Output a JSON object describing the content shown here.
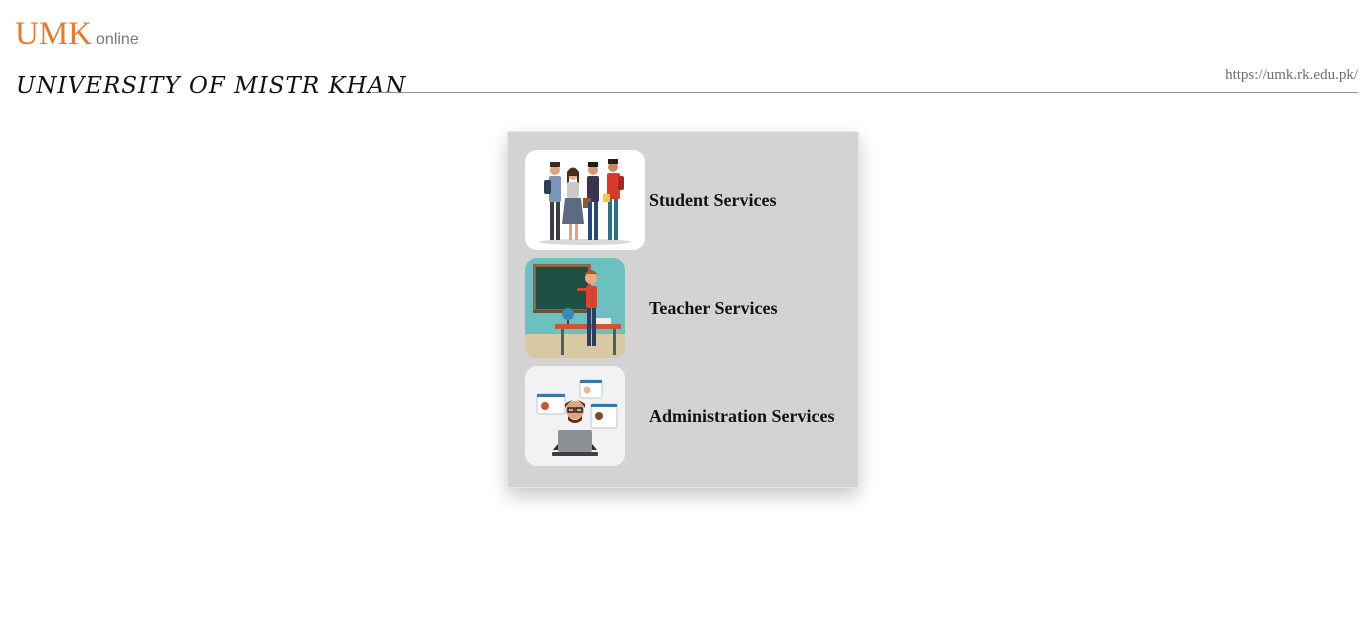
{
  "brand": {
    "name": "UMK",
    "suffix": "online"
  },
  "header": {
    "university_title": "UNIVERSITY OF MISTR KHAN",
    "url": "https://umk.rk.edu.pk/"
  },
  "services": [
    {
      "label": "Student Services",
      "icon": "students-illustration-icon"
    },
    {
      "label": "Teacher Services",
      "icon": "teacher-illustration-icon"
    },
    {
      "label": "Administration Services",
      "icon": "admin-illustration-icon"
    }
  ],
  "colors": {
    "brand_accent": "#e07d34",
    "panel_bg": "#d3d3d3"
  }
}
